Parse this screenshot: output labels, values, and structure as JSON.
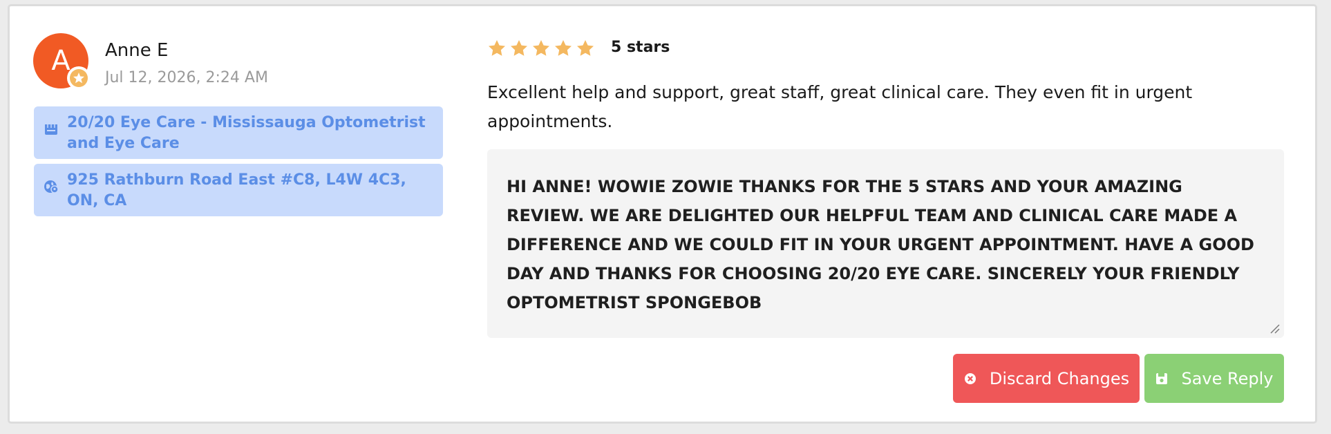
{
  "reviewer": {
    "initial": "A",
    "name": "Anne E",
    "date": "Jul 12, 2026, 2:24 AM",
    "avatar_color": "#f15a24",
    "badge_icon": "star-icon"
  },
  "location": {
    "store_name": "20/20 Eye Care - Mississauga Optometrist and Eye Care",
    "store_icon": "store-icon",
    "address": "925 Rathburn Road East #C8, L4W 4C3, ON, CA",
    "address_icon": "globe-pin-icon"
  },
  "rating": {
    "stars": 5,
    "max_stars": 5,
    "label": "5 stars",
    "star_color": "#f4b860"
  },
  "review": {
    "text": "Excellent help and support, great staff, great clinical care. They even fit in urgent appointments."
  },
  "reply": {
    "value": "Hi Anne! Wowie zowie thanks for the 5 stars and your amazing review. We are delighted our helpful team and clinical care made a difference and we could fit in your urgent appointment. Have a good day and thanks for choosing 20/20 Eye Care. Sincerely your friendly Optometrist SpongeBob"
  },
  "actions": {
    "discard_label": "Discard Changes",
    "discard_icon": "close-circle-icon",
    "discard_color": "#ef5758",
    "save_label": "Save Reply",
    "save_icon": "floppy-disk-icon",
    "save_color": "#8bd075"
  }
}
